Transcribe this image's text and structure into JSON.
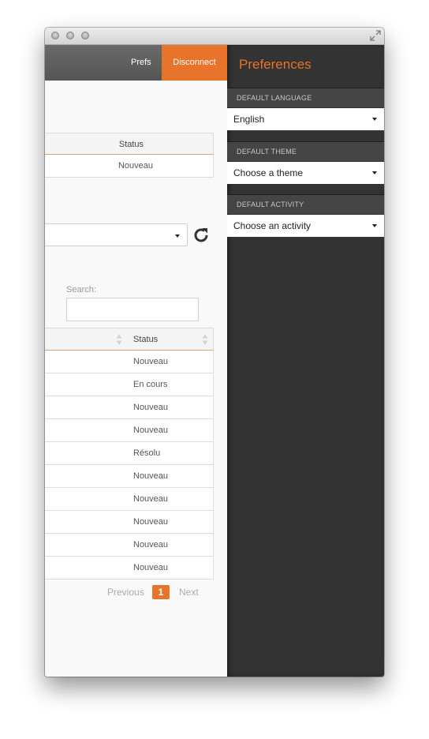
{
  "header": {
    "prefs_label": "Prefs",
    "disconnect_label": "Disconnect"
  },
  "top_table": {
    "header_status": "Status",
    "rows": [
      "Nouveau"
    ]
  },
  "search": {
    "label": "Search:",
    "value": ""
  },
  "main_table": {
    "header_status": "Status",
    "rows": [
      "Nouveau",
      "En cours",
      "Nouveau",
      "Nouveau",
      "Résolu",
      "Nouveau",
      "Nouveau",
      "Nouveau",
      "Nouveau",
      "Nouveau"
    ]
  },
  "pagination": {
    "previous": "Previous",
    "current": "1",
    "next": "Next"
  },
  "preferences": {
    "title": "Preferences",
    "language_label": "DEFAULT LANGUAGE",
    "language_value": "English",
    "theme_label": "DEFAULT THEME",
    "theme_value": "Choose a theme",
    "activity_label": "DEFAULT ACTIVITY",
    "activity_value": "Choose an activity"
  },
  "colors": {
    "accent": "#e8732a",
    "panel_dark": "#333333",
    "topbar": "#5f5f5f"
  },
  "icons": [
    "fullscreen-icon",
    "refresh-icon",
    "sort-icon",
    "caret-down-icon"
  ]
}
